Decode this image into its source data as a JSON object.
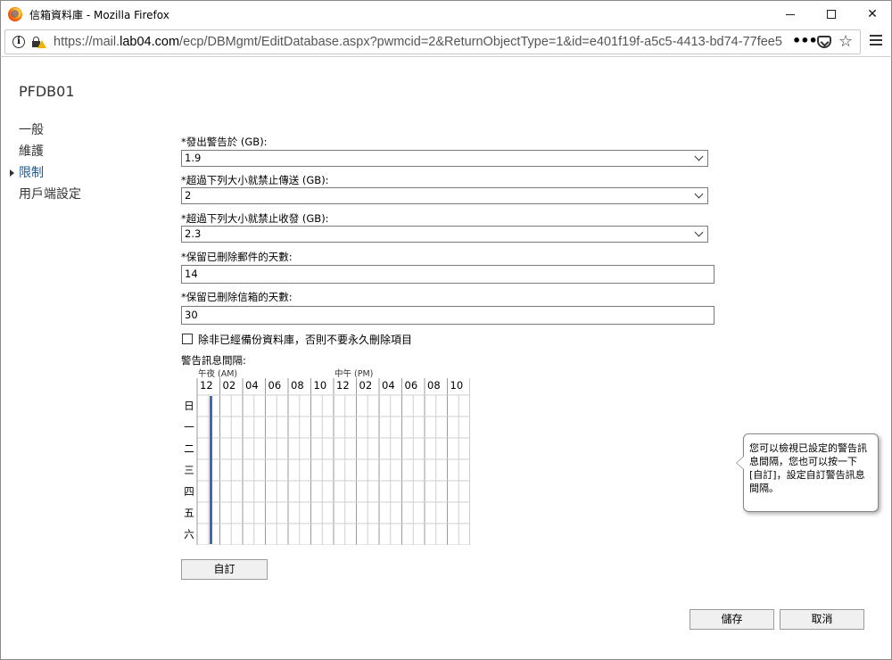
{
  "window": {
    "title": "信箱資料庫 - Mozilla Firefox",
    "minimize_glyph": "—",
    "url_prefix": "https://mail.",
    "url_host": "lab04.com",
    "url_rest": "/ecp/DBMgmt/EditDatabase.aspx?pwmcid=2&ReturnObjectType=1&id=e401f19f-a5c5-4413-bd74-77fee5",
    "more_glyph": "•••",
    "star_glyph": "☆"
  },
  "page": {
    "title": "PFDB01"
  },
  "nav": {
    "items": [
      {
        "label": "一般"
      },
      {
        "label": "維護"
      },
      {
        "label": "限制"
      },
      {
        "label": "用戶端設定"
      }
    ],
    "active": "限制"
  },
  "form": {
    "warning_label": "*發出警告於 (GB):",
    "warning_value": "1.9",
    "prohibit_send_label": "*超過下列大小就禁止傳送 (GB):",
    "prohibit_send_value": "2",
    "prohibit_receive_label": "*超過下列大小就禁止收發 (GB):",
    "prohibit_receive_value": "2.3",
    "keep_items_label": "*保留已刪除郵件的天數:",
    "keep_items_value": "14",
    "keep_mailboxes_label": "*保留已刪除信箱的天數:",
    "keep_mailboxes_value": "30",
    "backup_checkbox_label": "除非已經備份資料庫，否則不要永久刪除項目",
    "backup_checkbox_checked": false
  },
  "schedule": {
    "label": "警告訊息間隔:",
    "am_label": "午夜 (AM)",
    "pm_label": "中午 (PM)",
    "hours": [
      "12",
      "02",
      "04",
      "06",
      "08",
      "10",
      "12",
      "02",
      "04",
      "06",
      "08",
      "10"
    ],
    "days": [
      "日",
      "一",
      "二",
      "三",
      "四",
      "五",
      "六"
    ],
    "marker_color": "#3b6bb5",
    "customize_button": "自訂"
  },
  "tooltip": {
    "text": "您可以檢視已設定的警告訊息間隔，您也可以按一下 [自訂]，設定自訂警告訊息間隔。"
  },
  "buttons": {
    "save": "儲存",
    "cancel": "取消"
  }
}
